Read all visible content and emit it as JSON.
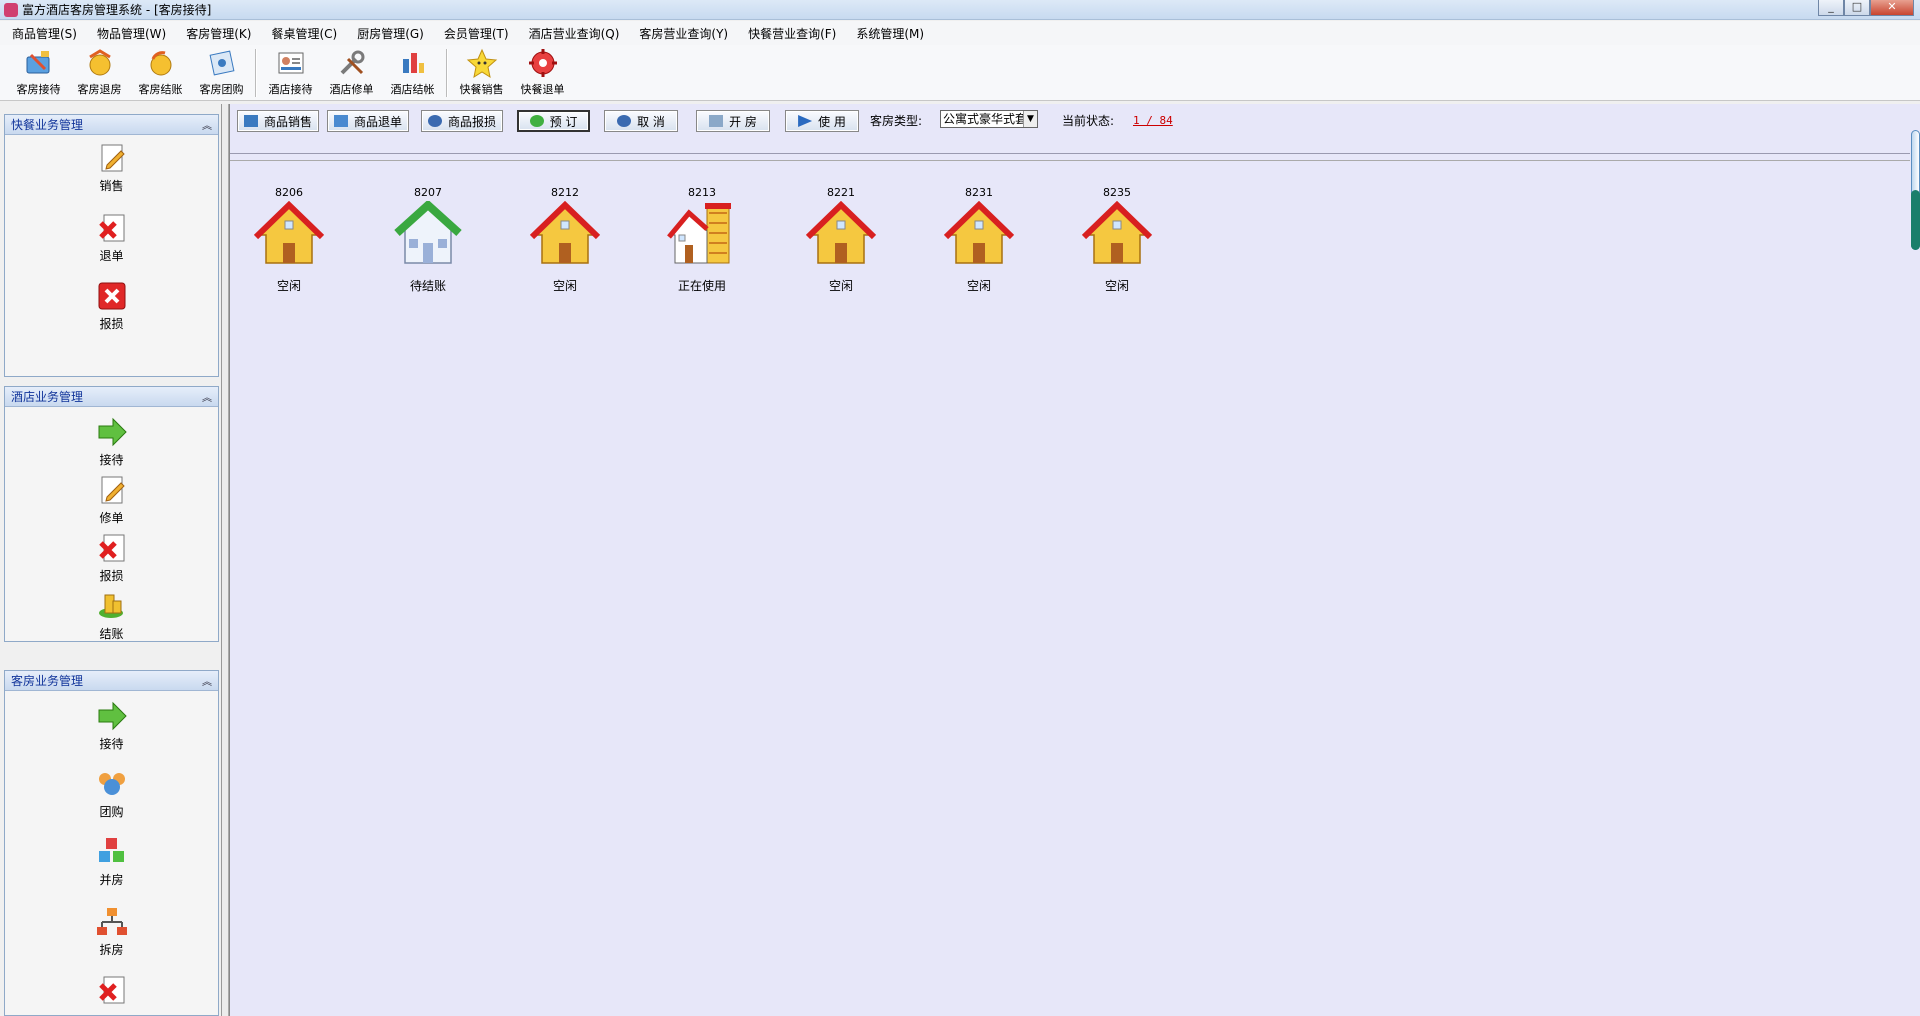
{
  "window": {
    "title": "富方酒店客房管理系统 - [客房接待]",
    "controls": [
      "_",
      "□",
      "✕"
    ]
  },
  "menu": [
    "商品管理(S)",
    "物品管理(W)",
    "客房管理(K)",
    "餐桌管理(C)",
    "厨房管理(G)",
    "会员管理(T)",
    "酒店营业查询(Q)",
    "客房营业查询(Y)",
    "快餐营业查询(F)",
    "系统管理(M)"
  ],
  "toolbar": [
    {
      "label": "客房接待",
      "icon": "reception-icon"
    },
    {
      "label": "客房退房",
      "icon": "checkout-icon"
    },
    {
      "label": "客房结账",
      "icon": "settle-icon"
    },
    {
      "label": "客房团购",
      "icon": "group-buy-icon"
    },
    {
      "label": "酒店接待",
      "icon": "hotel-reception-icon"
    },
    {
      "label": "酒店修单",
      "icon": "tools-icon"
    },
    {
      "label": "酒店结帐",
      "icon": "hotel-settle-icon"
    },
    {
      "label": "快餐销售",
      "icon": "star-icon"
    },
    {
      "label": "快餐退单",
      "icon": "gear-icon"
    }
  ],
  "left_panel": {
    "groups": [
      {
        "title": "快餐业务管理",
        "items": [
          "销售",
          "退单",
          "报损"
        ]
      },
      {
        "title": "酒店业务管理",
        "items": [
          "接待",
          "修单",
          "报损",
          "结账"
        ]
      },
      {
        "title": "客房业务管理",
        "items": [
          "接待",
          "团购",
          "并房",
          "拆房"
        ]
      }
    ]
  },
  "actions": {
    "buttons": [
      "商品销售",
      "商品退单",
      "商品报损",
      "预 订",
      "取 消",
      "开 房",
      "使 用"
    ],
    "room_type_label": "客房类型:",
    "room_type_value": "公寓式豪华式套",
    "status_label": "当前状态:",
    "status_value": "1 / 84"
  },
  "rooms": [
    {
      "number": "8206",
      "status": "空闲",
      "kind": "idle"
    },
    {
      "number": "8207",
      "status": "待结账",
      "kind": "pending"
    },
    {
      "number": "8212",
      "status": "空闲",
      "kind": "idle"
    },
    {
      "number": "8213",
      "status": "正在使用",
      "kind": "inuse"
    },
    {
      "number": "8221",
      "status": "空闲",
      "kind": "idle"
    },
    {
      "number": "8231",
      "status": "空闲",
      "kind": "idle"
    },
    {
      "number": "8235",
      "status": "空闲",
      "kind": "idle"
    }
  ],
  "colors": {
    "accent": "#11349a",
    "main_bg": "#e7e7f9",
    "status_link": "#cc0000"
  }
}
